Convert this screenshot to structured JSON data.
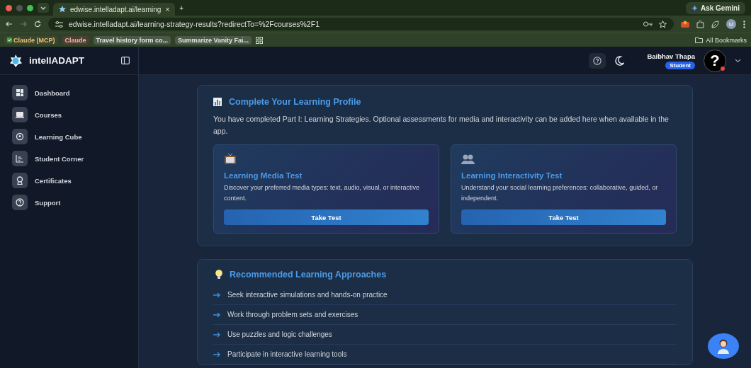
{
  "browser": {
    "tab": {
      "title": "edwise.intelladapt.ai/learning",
      "close": "×"
    },
    "new_tab": "+",
    "ask_gemini": "Ask Gemini",
    "url": "edwise.intelladapt.ai/learning-strategy-results?redirectTo=%2Fcourses%2F1",
    "profile_initial": "M",
    "bookmarks": [
      {
        "label": "Claude (MCP)",
        "kind": "checked"
      },
      {
        "label": "Claude",
        "kind": "tinted"
      },
      {
        "label": "Travel history form co...",
        "kind": "plain"
      },
      {
        "label": "Summarize Vanity Fai...",
        "kind": "plain"
      }
    ],
    "all_bookmarks": "All Bookmarks"
  },
  "app": {
    "logo": "intellADAPT"
  },
  "sidebar": {
    "items": [
      {
        "label": "Dashboard",
        "selected": false
      },
      {
        "label": "Courses",
        "selected": false
      },
      {
        "label": "Learning Cube",
        "selected": false
      },
      {
        "label": "Student Corner",
        "selected": false
      },
      {
        "label": "Certificates",
        "selected": false
      },
      {
        "label": "Support",
        "selected": false
      }
    ]
  },
  "header": {
    "user_name": "Baibhav Thapa",
    "role": "Student",
    "avatar": "?"
  },
  "profile_card": {
    "title": "Complete Your Learning Profile",
    "text": "You have completed Part I: Learning Strategies. Optional assessments for media and interactivity can be added here when available in the app.",
    "tests": [
      {
        "title": "Learning Media Test",
        "text": "Discover your preferred media types: text, audio, visual, or interactive content.",
        "button": "Take Test"
      },
      {
        "title": "Learning Interactivity Test",
        "text": "Understand your social learning preferences: collaborative, guided, or independent.",
        "button": "Take Test"
      }
    ]
  },
  "approaches": {
    "title": "Recommended Learning Approaches",
    "items": [
      "Seek interactive simulations and hands-on practice",
      "Work through problem sets and exercises",
      "Use puzzles and logic challenges",
      "Participate in interactive learning tools"
    ]
  }
}
